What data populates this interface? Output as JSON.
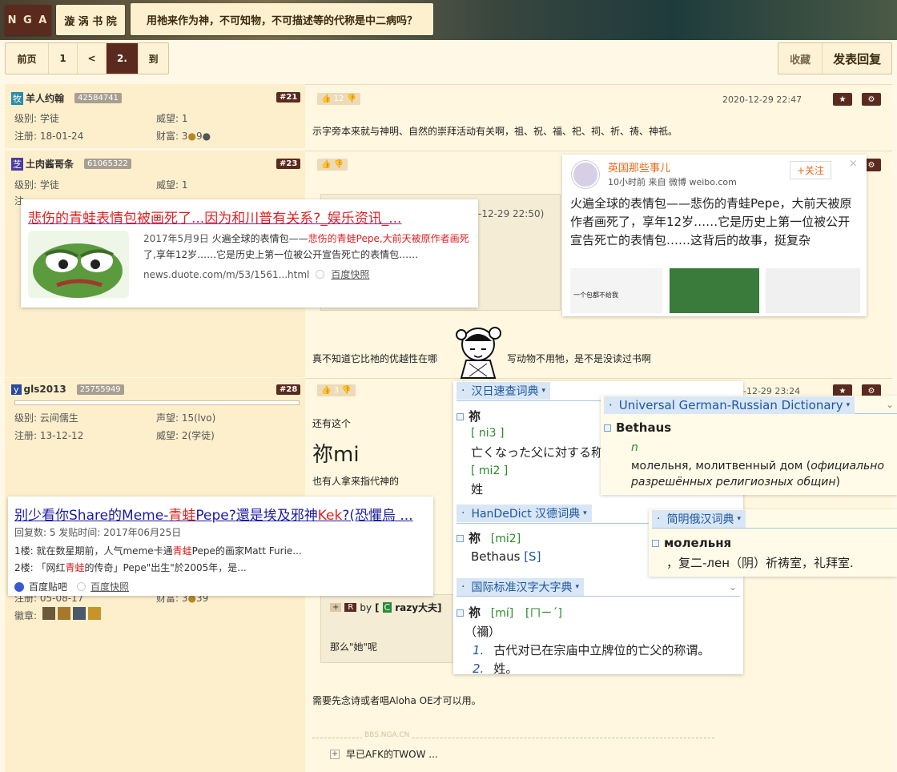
{
  "header": {
    "logo": "N G A",
    "forum": "漩 涡 书 院",
    "thread_title": "用祂来作为神，不可知物，不可描述等的代称是中二病吗？"
  },
  "pager": {
    "first": "前页",
    "p1": "1",
    "prev": "<",
    "current": "2.",
    "goto": "到",
    "favorite": "收藏",
    "reply": "发表回复"
  },
  "posts": [
    {
      "user": "羊人约翰",
      "avatar_char": "牧",
      "uid": "42584741",
      "floor": "#21",
      "likes": "12",
      "time": "2020-12-29 22:47",
      "level": "级别: 学徒",
      "reputation": "威望: 1",
      "reg": "注册: 18-01-24",
      "wealth": "财富: 3",
      "wealth2": "9",
      "content": "示字旁本来就与神明、自然的崇拜活动有关啊，祖、祝、福、祀、祠、祈、祷、神祇。"
    },
    {
      "user": "土肉酱哥条",
      "avatar_char": "芝",
      "uid": "61065322",
      "floor": "#23",
      "level": "级别: 学徒",
      "reputation": "威望: 1",
      "reg_partial": "注",
      "time_partial": "-12-29 22:50)",
      "content_a": "真不知道它比祂的优越性在哪",
      "content_b": "写动物不用牠，是不是没读过书啊"
    },
    {
      "user": "gls2013",
      "avatar_char": "y",
      "uid": "25755949",
      "floor": "#28",
      "likes": "3",
      "time_partial": "-12-29 23:24",
      "level": "级别: 云间儒生",
      "fame": "声望: 15(lvo)",
      "reg": "注册: 13-12-12",
      "reputation": "威望: 2(学徒)",
      "content_a": "还有这个",
      "big": "祢mi",
      "content_b": "也有人拿来指代神的"
    },
    {
      "reg_partial": "注册: 05-08-17",
      "wealth_partial": "财富: 3",
      "wealth2": "39",
      "badges_label": "徽章:",
      "quote_by": "by",
      "quote_user": "razy大夫]",
      "quote_user_char": "C",
      "quote_content": "那么\"她\"呢",
      "content": "需要先念诗或者唱Aloha OE才可以用。",
      "watermark": "BBS.NGA.CN",
      "collapsed": "早已AFK的TWOW ..."
    }
  ],
  "search_card_1": {
    "title": "悲伤的青蛙表情包被画死了...因为和川普有关系?_娱乐资讯_...",
    "date": "2017年5月9日",
    "snippet_a": "火遍全球的表情包——",
    "snippet_red": "悲伤的青蛙Pepe,大前天被原作者画死",
    "snippet_b": "了,享年12岁……它是历史上第一位被公开宣告死亡的表情包……",
    "url": "news.duote.com/m/53/1561...html",
    "snapshot": "百度快照"
  },
  "weibo": {
    "account": "英国那些事儿",
    "meta": "10小时前  来自 微博 weibo.com",
    "follow": "+关注",
    "text": "火遍全球的表情包——悲伤的青蛙Pepe，大前天被原作者画死了，享年12岁……它是历史上第一位被公开宣告死亡的表情包……这背后的故事，挺复杂",
    "thumb_caption": "一个包都不给我"
  },
  "search_card_2": {
    "title_a": "别少看你Share的Meme-",
    "title_red": "青蛙",
    "title_b": "Pepe?還是埃及邪神",
    "title_red2": "Kek",
    "title_c": "?(恐懼烏 ...",
    "meta": "回复数: 5 发贴时间: 2017年06月25日",
    "line1_a": "1楼: 就在数星期前，人气meme卡通",
    "line1_red": "青蛙",
    "line1_b": "Pepe的画家Matt Furie...",
    "line2_a": "2楼: 「网红",
    "line2_red": "青蛙",
    "line2_b": "的传奇」Pepe\"出生\"於2005年，是...",
    "source": "百度贴吧",
    "snapshot": "百度快照"
  },
  "dict": {
    "jp_name": "汉日速查词典",
    "jp_word": "祢",
    "jp_pron1": "[ ni3 ]",
    "jp_def1": "亡くなった父に対する称",
    "jp_pron2": "[ mi2 ]",
    "jp_def2": "姓",
    "de_ru_name": "Universal German-Russian Dictionary",
    "de_word": "Bethaus",
    "de_pos": "n",
    "de_def_a": "молельня, молитвенный дом (",
    "de_def_italic": "официально разрешённых религиозных общин",
    "de_def_b": ")",
    "hd_name": "HanDeDict 汉德词典",
    "hd_word": "祢",
    "hd_pron": "[mi2]",
    "hd_def": "Bethaus",
    "hd_tag": "[S]",
    "ru_name": "简明俄汉词典",
    "ru_word": "молельня",
    "ru_def": "，复二-лен（阴）祈祷室，礼拜室.",
    "intl_name": "国际标准汉字大字典",
    "intl_word": "祢",
    "intl_pron": "[mí]",
    "intl_bopo": "[ㄇㄧˊ]",
    "intl_trad": "（禰）",
    "intl_def1": "古代对已在宗庙中立牌位的亡父的称谓。",
    "intl_def2": "姓。"
  },
  "colors": {
    "accent": "#5a2a1e",
    "post_bg": "#fff7df",
    "dict_blue": "#1e57a0",
    "link_red": "#e02020"
  }
}
